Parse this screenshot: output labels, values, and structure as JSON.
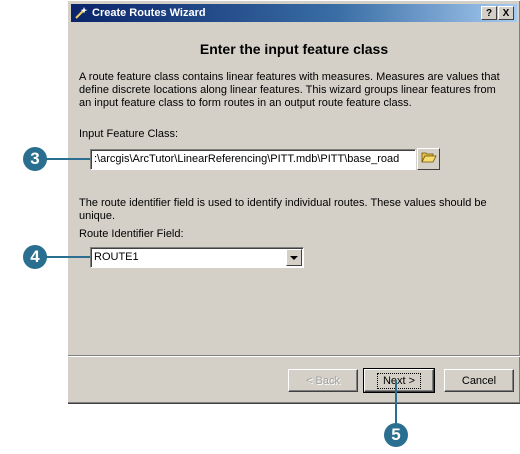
{
  "window": {
    "title": "Create Routes Wizard",
    "help_label": "?",
    "close_label": "X"
  },
  "page": {
    "heading": "Enter the input feature class",
    "description": "A route feature class contains linear features with measures.  Measures are values that define discrete locations along linear features.  This wizard groups linear features from an input feature class to form routes in an output route feature class.",
    "input_label": "Input Feature Class:",
    "input_value": ":\\arcgis\\ArcTutor\\LinearReferencing\\PITT.mdb\\PITT\\base_road",
    "route_description": "The route identifier field is used to identify individual routes.  These values should be unique.",
    "route_label": "Route Identifier Field:",
    "route_value": "ROUTE1"
  },
  "buttons": {
    "back": "< Back",
    "next": "Next >",
    "cancel": "Cancel"
  },
  "callouts": {
    "input": "3",
    "route": "4",
    "next": "5"
  },
  "colors": {
    "title_gradient_start": "#0a246a",
    "dialog_face": "#d4d0c8",
    "callout": "#2a6f8f"
  }
}
